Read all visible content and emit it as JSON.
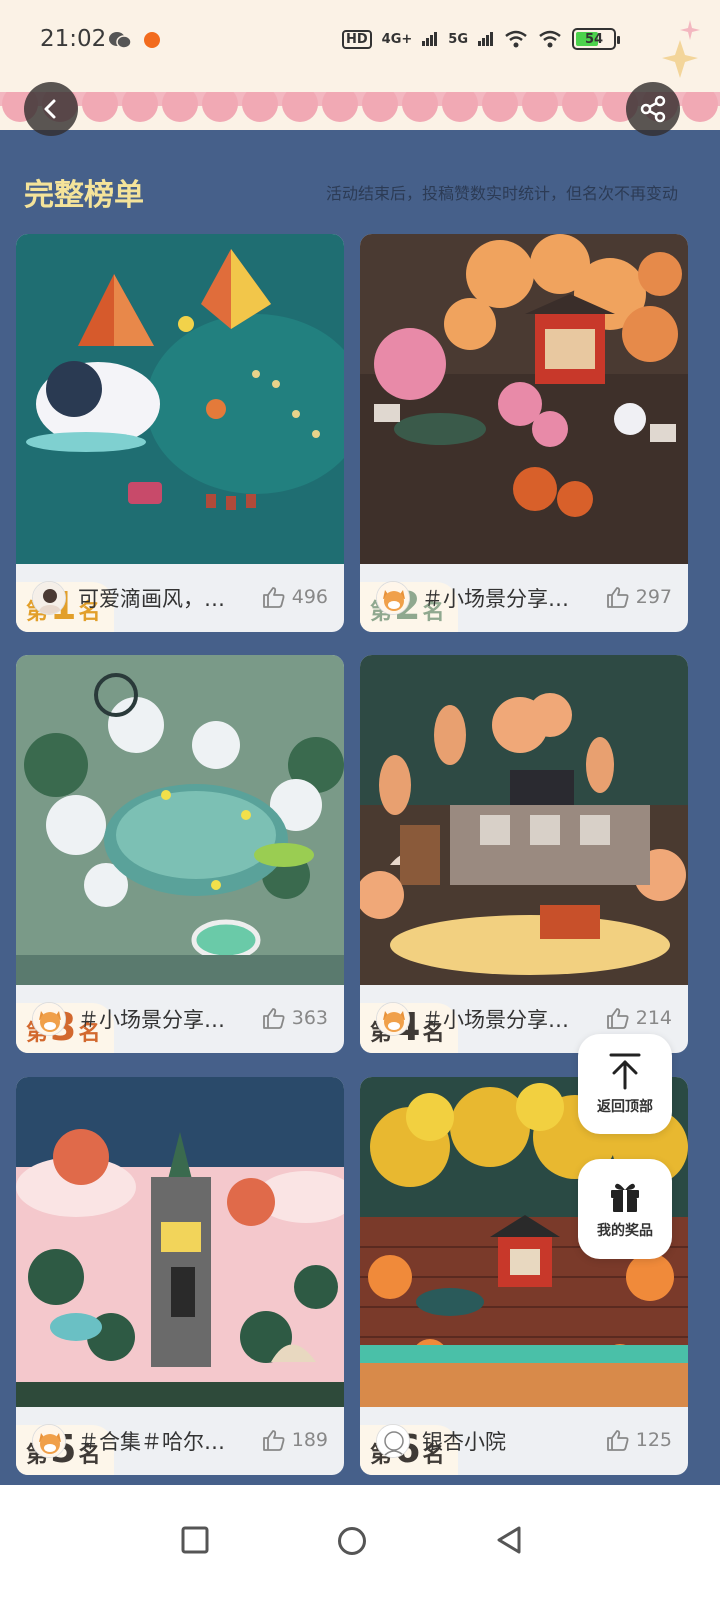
{
  "status_bar": {
    "time": "21:02",
    "hd_label": "HD",
    "net1": "4G+",
    "net2": "5G",
    "battery": "54"
  },
  "header": {
    "back_icon": "chevron-left-icon",
    "share_icon": "share-icon"
  },
  "section": {
    "title": "完整榜单",
    "note": "活动结束后，投稿赞数实时统计，但名次不再变动"
  },
  "rank_prefix": "第",
  "rank_suffix": "名",
  "cards": [
    {
      "rank": "1",
      "title": "可爱滴画风，…",
      "likes": "496"
    },
    {
      "rank": "2",
      "title": "＃小场景分享…",
      "likes": "297"
    },
    {
      "rank": "3",
      "title": "＃小场景分享…",
      "likes": "363"
    },
    {
      "rank": "4",
      "title": "＃小场景分享…",
      "likes": "214"
    },
    {
      "rank": "5",
      "title": "＃合集＃哈尔…",
      "likes": "189"
    },
    {
      "rank": "6",
      "title": "银杏小院",
      "likes": "125"
    }
  ],
  "floating": {
    "back_top": "返回顶部",
    "my_prizes": "我的奖品"
  },
  "colors": {
    "page_bg": "#46608a",
    "title_yellow": "#f4e39a",
    "rank_gold": "#e29f2a",
    "rank_silver": "#8fa88f",
    "rank_bronze": "#d2682e"
  }
}
